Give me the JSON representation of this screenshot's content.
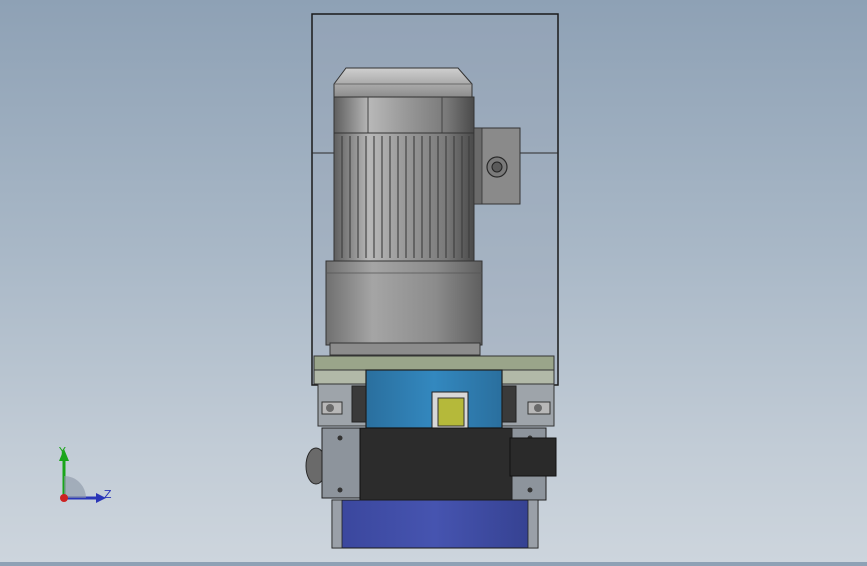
{
  "view": {
    "name": "cad-front-view",
    "model": "hydraulic-power-unit"
  },
  "triad": {
    "y_label": "Y",
    "z_label": "Z"
  },
  "colors": {
    "background_top": "#8ea1b5",
    "background_bottom": "#cdd5dd",
    "motor_grey": "#9a9a9a",
    "valve_blue": "#2e7fb6",
    "tank_blue": "#3f4fa8",
    "solenoid_dark": "#2c2c2c",
    "adapter_green": "#9aa58a",
    "y_axis": "#1aa51a",
    "z_axis": "#2a36b8",
    "x_axis": "#cc2222"
  },
  "icons": {
    "triad": "coordinate-triad-icon"
  }
}
